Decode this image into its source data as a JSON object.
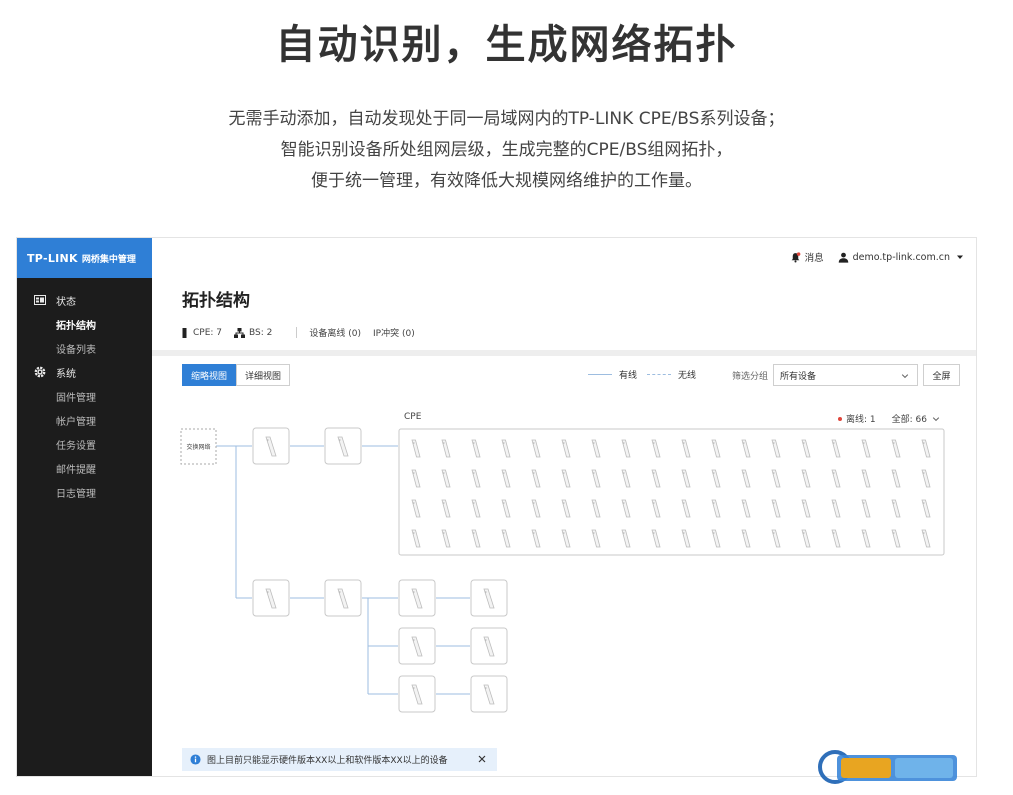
{
  "hero": {
    "title": "自动识别，生成网络拓扑",
    "lines": [
      "无需手动添加，自动发现处于同一局域网内的TP-LINK CPE/BS系列设备；",
      "智能识别设备所处组网层级，生成完整的CPE/BS组网拓扑，",
      "便于统一管理，有效降低大规模网络维护的工作量。"
    ]
  },
  "sidebar": {
    "logo": "TP-LINK",
    "product": "网桥集中管理",
    "items": [
      {
        "label": "状态",
        "type": "group",
        "icon": "dashboard-icon"
      },
      {
        "label": "拓扑结构",
        "type": "item",
        "active": true
      },
      {
        "label": "设备列表",
        "type": "item"
      },
      {
        "label": "系统",
        "type": "group",
        "icon": "gear-icon"
      },
      {
        "label": "固件管理",
        "type": "item"
      },
      {
        "label": "帐户管理",
        "type": "item"
      },
      {
        "label": "任务设置",
        "type": "item"
      },
      {
        "label": "邮件提醒",
        "type": "item"
      },
      {
        "label": "日志管理",
        "type": "item"
      }
    ]
  },
  "topbar": {
    "messages_label": "消息",
    "user": "demo.tp-link.com.cn"
  },
  "page": {
    "title": "拓扑结构",
    "stats": {
      "cpe": "CPE: 7",
      "bs": "BS: 2",
      "offline": "设备离线 (0)",
      "ip_conflict": "IP冲突 (0)"
    }
  },
  "toolbar": {
    "view_brief": "缩略视图",
    "view_detail": "详细视图",
    "legend_wired": "有线",
    "legend_wireless": "无线",
    "filter_label": "筛选分组",
    "filter_value": "所有设备",
    "fullscreen": "全屏"
  },
  "topology": {
    "switch_label": "交换网络",
    "cpe_group_label": "CPE",
    "offline_summary": "离线: 1",
    "total_summary": "全部: 66",
    "grid_rows": 4,
    "grid_cols": 18
  },
  "notice": {
    "text": "图上目前只能显示硬件版本XX以上和软件版本XX以上的设备"
  },
  "colors": {
    "accent": "#2f7fd6",
    "sidebar_bg": "#1c1c1c",
    "link_line": "#9dbde0",
    "offline_dot": "#e0463b",
    "notice_bg": "#e6f0fb"
  }
}
